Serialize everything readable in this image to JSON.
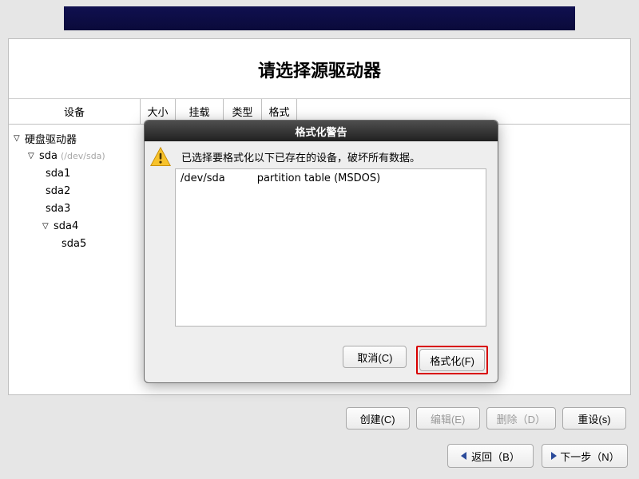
{
  "page_title": "请选择源驱动器",
  "columns": {
    "device": "设备",
    "size": "大小",
    "mount": "挂载点/",
    "type": "类型",
    "format": "格式"
  },
  "tree": {
    "root_label": "硬盘驱动器",
    "disk_label": "sda",
    "disk_path": "(/dev/sda)",
    "parts": [
      "sda1",
      "sda2",
      "sda3"
    ],
    "ext_label": "sda4",
    "ext_child": "sda5"
  },
  "dialog": {
    "title": "格式化警告",
    "message": "已选择要格式化以下已存在的设备，破坏所有数据。",
    "device": "/dev/sda",
    "detail": "partition table (MSDOS)",
    "cancel": "取消(C)",
    "format": "格式化(F)"
  },
  "actions": {
    "create": "创建(C)",
    "edit": "编辑(E)",
    "delete": "删除（D）",
    "reset": "重设(s)"
  },
  "nav": {
    "back": "返回（B）",
    "next": "下一步（N）"
  }
}
